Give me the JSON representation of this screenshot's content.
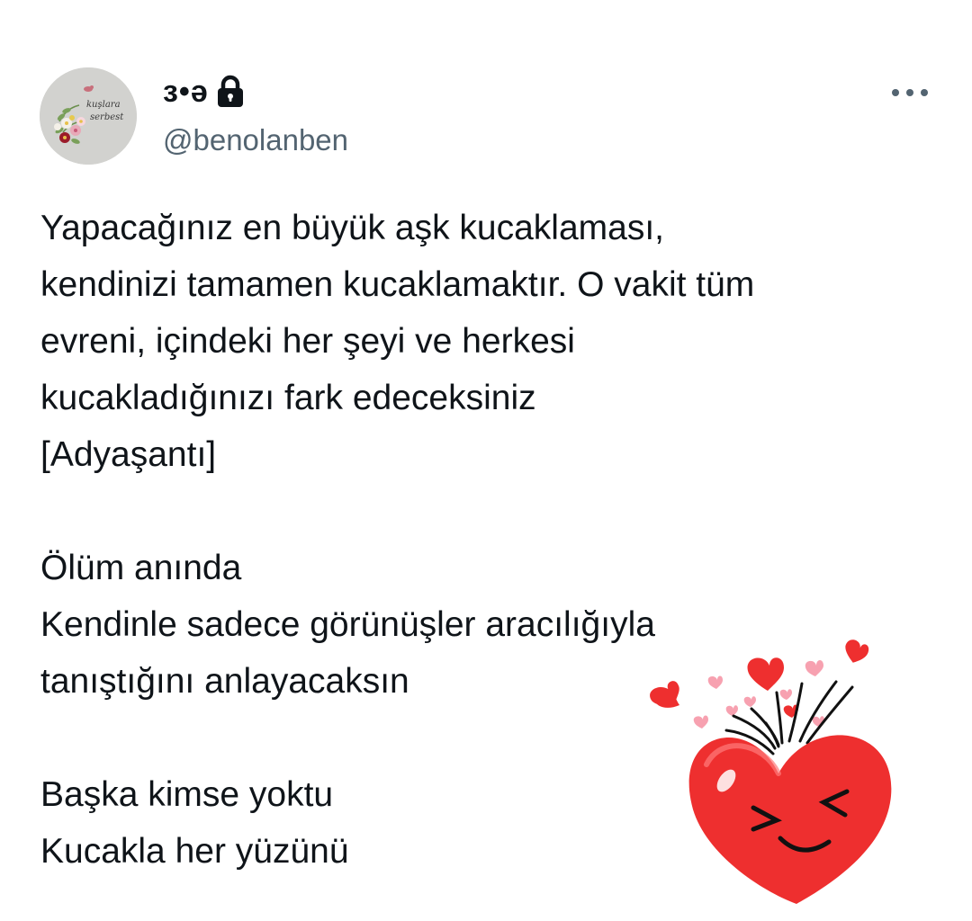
{
  "tweet": {
    "author": {
      "display_name": "з•ә",
      "handle": "@benolanben",
      "avatar_text": [
        "kuşlara",
        "serbest"
      ],
      "locked": true
    },
    "more_icon": "more-horizontal-icon",
    "text_lines": [
      "Yapacağınız en büyük aşk kucaklaması,",
      "kendinizi tamamen kucaklamaktır. O vakit tüm",
      "evreni, içindeki her şeyi ve herkesi",
      "kucakladığınızı fark edeceksiniz",
      "[Adyaşantı]",
      "",
      "Ölüm anında",
      "Kendinle sadece görünüşler aracılığıyla",
      "tanıştığını anlayacaksın",
      "",
      "Başka kimse yoktu",
      "Kucakla her yüzünü"
    ],
    "sticker": "laughing-heart-sticker"
  },
  "colors": {
    "text": "#0f1419",
    "secondary": "#536471",
    "heart_red": "#ee2f2f",
    "heart_pink": "#f7a1b0"
  }
}
